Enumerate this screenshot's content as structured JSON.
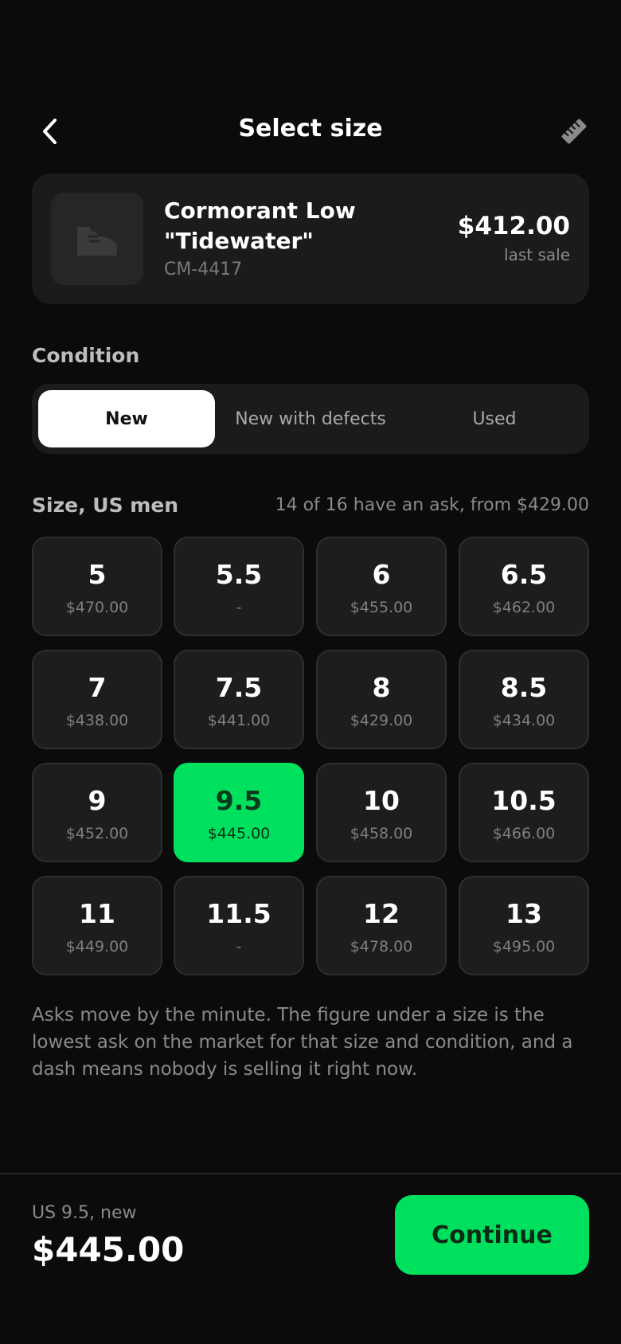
{
  "header": {
    "title": "Select size",
    "back_icon": "chevron-left-icon",
    "ruler_icon": "ruler-icon"
  },
  "product": {
    "name": "Cormorant Low \"Tidewater\"",
    "sku": "CM-4417",
    "price": "$412.00",
    "price_caption": "last sale",
    "thumb_icon": "sneaker-icon"
  },
  "condition": {
    "label": "Condition",
    "options": [
      "New",
      "New with defects",
      "Used"
    ],
    "selected": "New"
  },
  "sizes": {
    "label": "Size, US men",
    "meta": "14 of 16 have an ask, from $429.00",
    "selected": "9.5",
    "accent_color": "#00e05f",
    "tiles": [
      {
        "size": "5",
        "price": "$470.00"
      },
      {
        "size": "5.5",
        "price": "-"
      },
      {
        "size": "6",
        "price": "$455.00"
      },
      {
        "size": "6.5",
        "price": "$462.00"
      },
      {
        "size": "7",
        "price": "$438.00"
      },
      {
        "size": "7.5",
        "price": "$441.00"
      },
      {
        "size": "8",
        "price": "$429.00"
      },
      {
        "size": "8.5",
        "price": "$434.00"
      },
      {
        "size": "9",
        "price": "$452.00"
      },
      {
        "size": "9.5",
        "price": "$445.00"
      },
      {
        "size": "10",
        "price": "$458.00"
      },
      {
        "size": "10.5",
        "price": "$466.00"
      },
      {
        "size": "11",
        "price": "$449.00"
      },
      {
        "size": "11.5",
        "price": "-"
      },
      {
        "size": "12",
        "price": "$478.00"
      },
      {
        "size": "13",
        "price": "$495.00"
      }
    ]
  },
  "note": "Asks move by the minute. The figure under a size is the lowest ask on the market for that size and condition, and a dash means nobody is selling it right now.",
  "footer": {
    "caption": "US 9.5, new",
    "price": "$445.00",
    "continue_label": "Continue"
  }
}
